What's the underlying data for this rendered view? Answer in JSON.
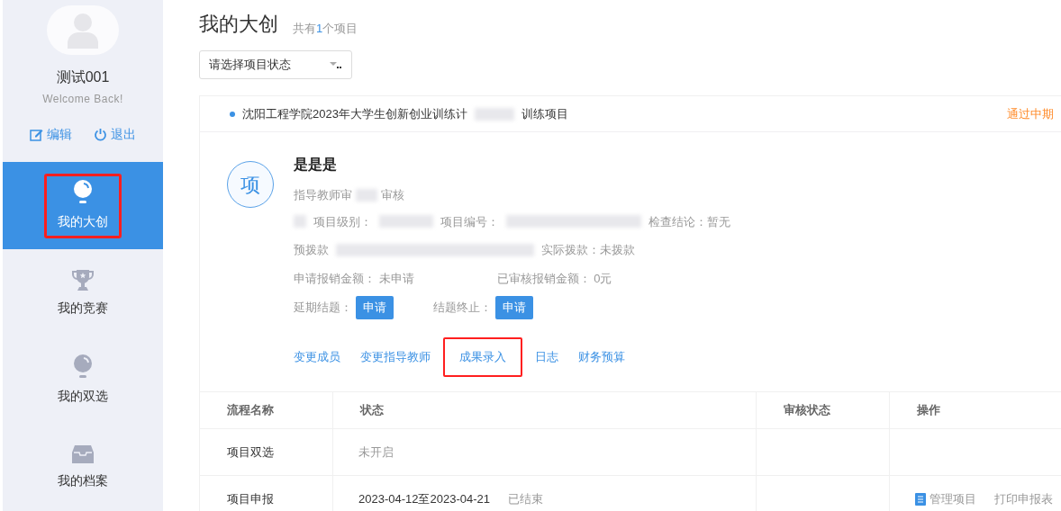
{
  "sidebar": {
    "user_name": "测试001",
    "welcome": "Welcome Back!",
    "actions": [
      {
        "kind": "edit",
        "label": "编辑"
      },
      {
        "kind": "logout",
        "label": "退出"
      }
    ],
    "items": [
      {
        "kind": "bulb",
        "label": "我的大创",
        "selected": true,
        "highlighted": true
      },
      {
        "kind": "trophy",
        "label": "我的竞赛",
        "selected": false,
        "highlighted": false
      },
      {
        "kind": "bulb",
        "label": "我的双选",
        "selected": false,
        "highlighted": false
      },
      {
        "kind": "box",
        "label": "我的档案",
        "selected": false,
        "highlighted": false
      }
    ]
  },
  "header": {
    "title": "我的大创",
    "count_prefix": "共有",
    "count": "1",
    "count_suffix": "个项目"
  },
  "status_select": {
    "placeholder": "请选择项目状态"
  },
  "project": {
    "program": "沈阳工程学院2023年大学生创新创业训练计",
    "program_tail": "训练项目",
    "stage": "通过中期",
    "avatar_char": "项",
    "name": "是是是",
    "teacher_review": "指导教师审",
    "teacher_review_tail": "审核",
    "info_row_1": [
      "项目级别：",
      "项目编号：",
      "检查结论：暂无"
    ],
    "info_row_2": [
      "预拨款",
      "实际拨款：未拨款"
    ],
    "reimburse": [
      {
        "label": "申请报销金额：",
        "value": "未申请"
      },
      {
        "label": "已审核报销金额：",
        "value": "0元"
      }
    ],
    "requests": [
      {
        "label": "延期结题：",
        "button": "申请"
      },
      {
        "label": "结题终止：",
        "button": "申请"
      }
    ],
    "links": [
      {
        "label": "变更成员",
        "highlighted": false
      },
      {
        "label": "变更指导教师",
        "highlighted": false
      },
      {
        "label": "成果录入",
        "highlighted": true
      },
      {
        "label": "日志",
        "highlighted": false
      },
      {
        "label": "财务预算",
        "highlighted": false
      }
    ]
  },
  "table": {
    "columns": [
      "流程名称",
      "状态",
      "审核状态",
      "操作"
    ],
    "rows": [
      {
        "name": "项目双选",
        "status": "未开启"
      },
      {
        "name": "项目申报",
        "dates": "2023-04-12至2023-04-21",
        "status": "已结束",
        "actions": [
          "管理项目",
          "打印申报表"
        ]
      }
    ]
  }
}
